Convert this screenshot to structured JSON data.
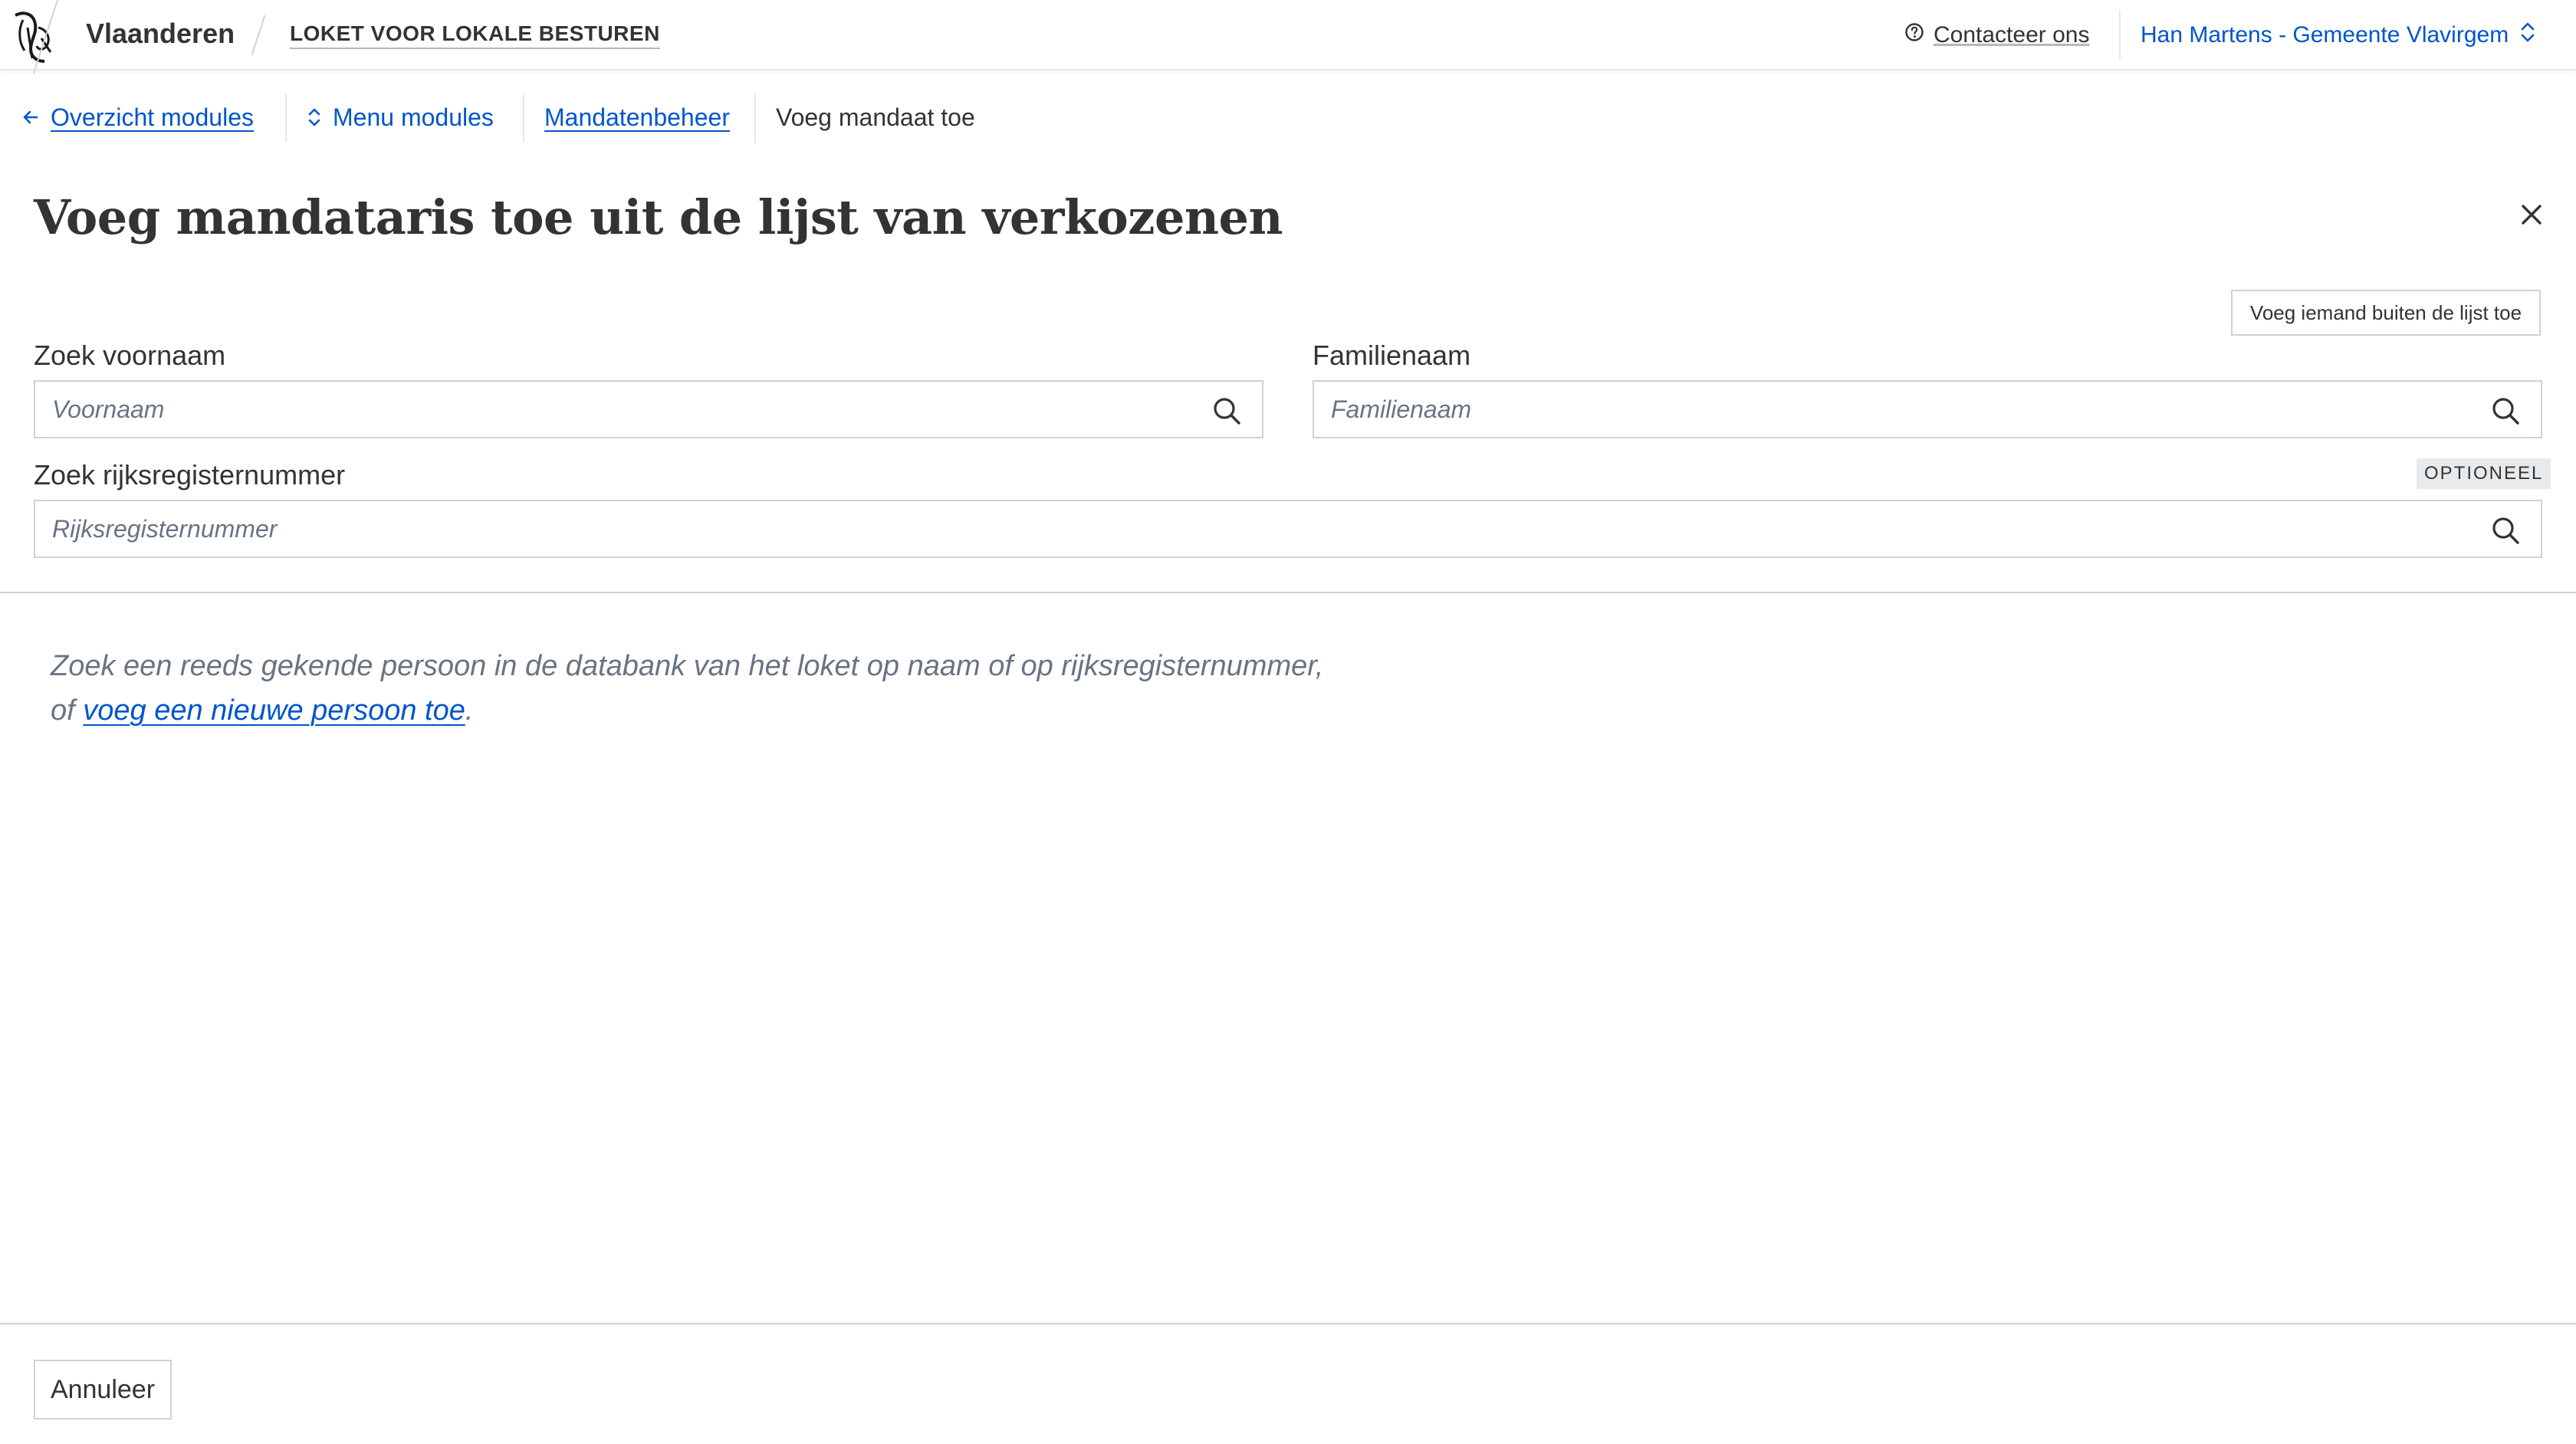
{
  "header": {
    "brand": "Vlaanderen",
    "app_title": "LOKET VOOR LOKALE BESTUREN",
    "contact_label": "Contacteer ons",
    "user_label": "Han Martens - Gemeente Vlavirgem"
  },
  "nav": {
    "back_label": "Overzicht modules",
    "menu_label": "Menu modules",
    "crumb_parent": "Mandatenbeheer",
    "crumb_current": "Voeg mandaat toe"
  },
  "page": {
    "title": "Voeg mandataris toe uit de lijst van verkozenen",
    "add_outside_label": "Voeg iemand buiten de lijst toe"
  },
  "form": {
    "first_name_label": "Zoek voornaam",
    "first_name_placeholder": "Voornaam",
    "last_name_label": "Familienaam",
    "last_name_placeholder": "Familienaam",
    "rrn_label": "Zoek rijksregisternummer",
    "rrn_placeholder": "Rijksregisternummer",
    "optional_badge": "OPTIONEEL"
  },
  "info": {
    "text_line1": "Zoek een reeds gekende persoon in de databank van het loket op naam of op rijksregisternummer,",
    "text_prefix2": "of ",
    "link_text": "voeg een nieuwe persoon toe",
    "text_suffix": "."
  },
  "footer": {
    "cancel_label": "Annuleer"
  },
  "colors": {
    "link": "#0055cc",
    "text": "#333332",
    "muted": "#687483",
    "border": "#cbd2da"
  },
  "icons": [
    "flemish-lion-logo",
    "help-circle-icon",
    "chevron-updown-icon",
    "arrow-left-icon",
    "close-icon",
    "search-icon"
  ]
}
